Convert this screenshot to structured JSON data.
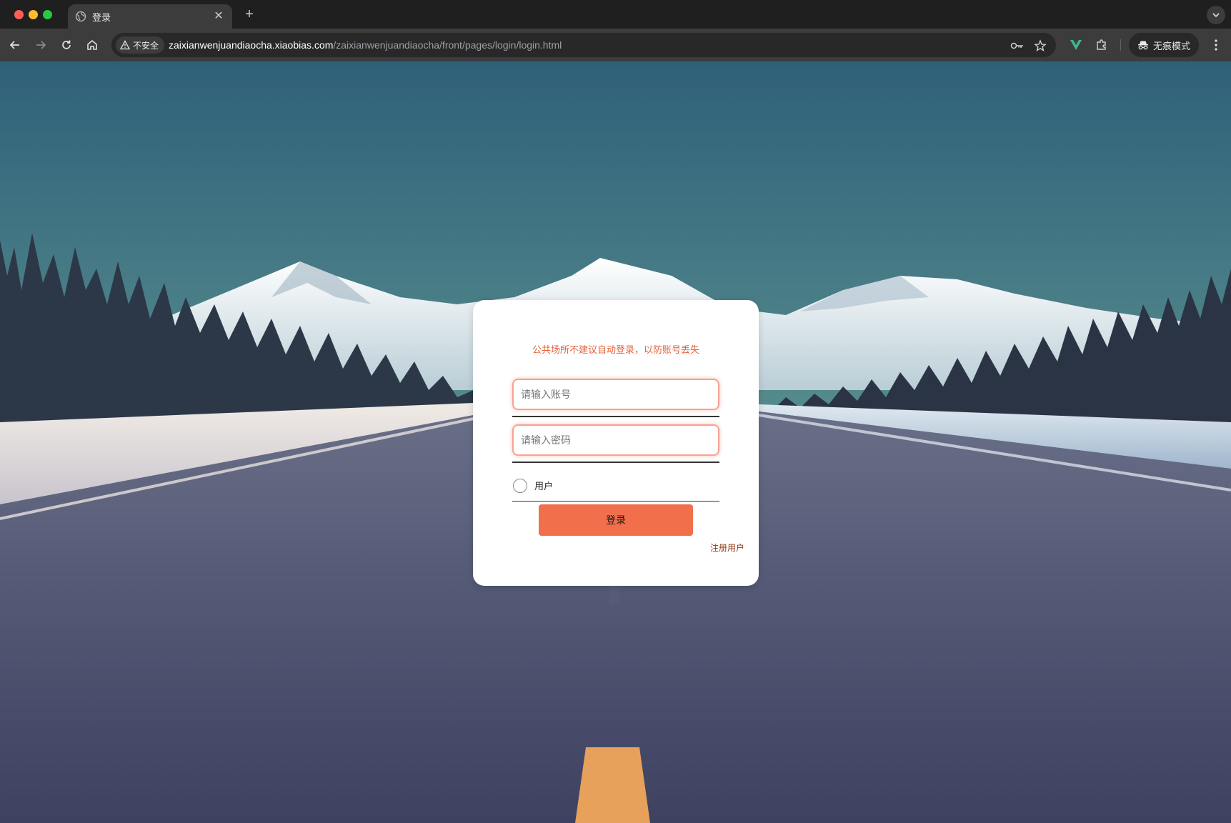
{
  "browser": {
    "tab_title": "登录",
    "security_label": "不安全",
    "url_host": "zaixianwenjuandiaocha.xiaobias.com",
    "url_path": "/zaixianwenjuandiaocha/front/pages/login/login.html",
    "incognito_label": "无痕模式"
  },
  "login": {
    "notice": "公共场所不建议自动登录，以防账号丢失",
    "account_placeholder": "请输入账号",
    "password_placeholder": "请输入密码",
    "role_option": "用户",
    "login_button": "登录",
    "register_link": "注册用户"
  },
  "colors": {
    "accent": "#f26f4c",
    "notice": "#e7613b",
    "input_border": "#f7a392"
  }
}
